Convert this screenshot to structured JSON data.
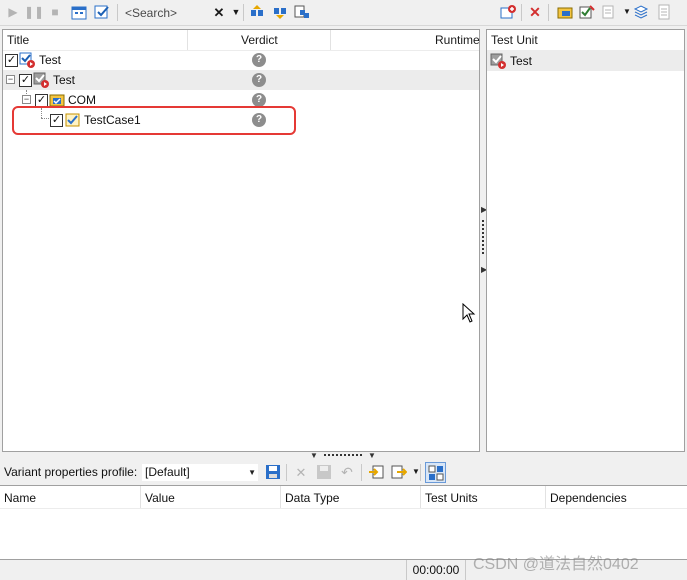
{
  "toolbar": {
    "search_placeholder": "<Search>",
    "clear_glyph": "✕"
  },
  "tree_panel": {
    "columns": [
      "Title",
      "Verdict",
      "Runtime"
    ],
    "rows": [
      {
        "title": "Test",
        "checked": "✓",
        "verdict": "?"
      },
      {
        "title": "Test",
        "checked": "✓",
        "verdict": "?"
      },
      {
        "title": "COM",
        "checked": "✓",
        "verdict": "?"
      },
      {
        "title": "TestCase1",
        "checked": "✓",
        "verdict": "?"
      }
    ]
  },
  "test_unit_panel": {
    "header": "Test Unit",
    "items": [
      {
        "label": "Test"
      }
    ]
  },
  "variant_bar": {
    "label": "Variant properties profile:",
    "selected": "[Default]"
  },
  "properties_table": {
    "columns": [
      "Name",
      "Value",
      "Data Type",
      "Test Units",
      "Dependencies"
    ]
  },
  "status": {
    "time": "00:00:00"
  },
  "watermark": "CSDN @道法自然0402",
  "colors": {
    "highlight": "#e53935",
    "selection": "#ececec",
    "icon_blue": "#2a6fc9",
    "icon_red": "#d32f2f"
  }
}
